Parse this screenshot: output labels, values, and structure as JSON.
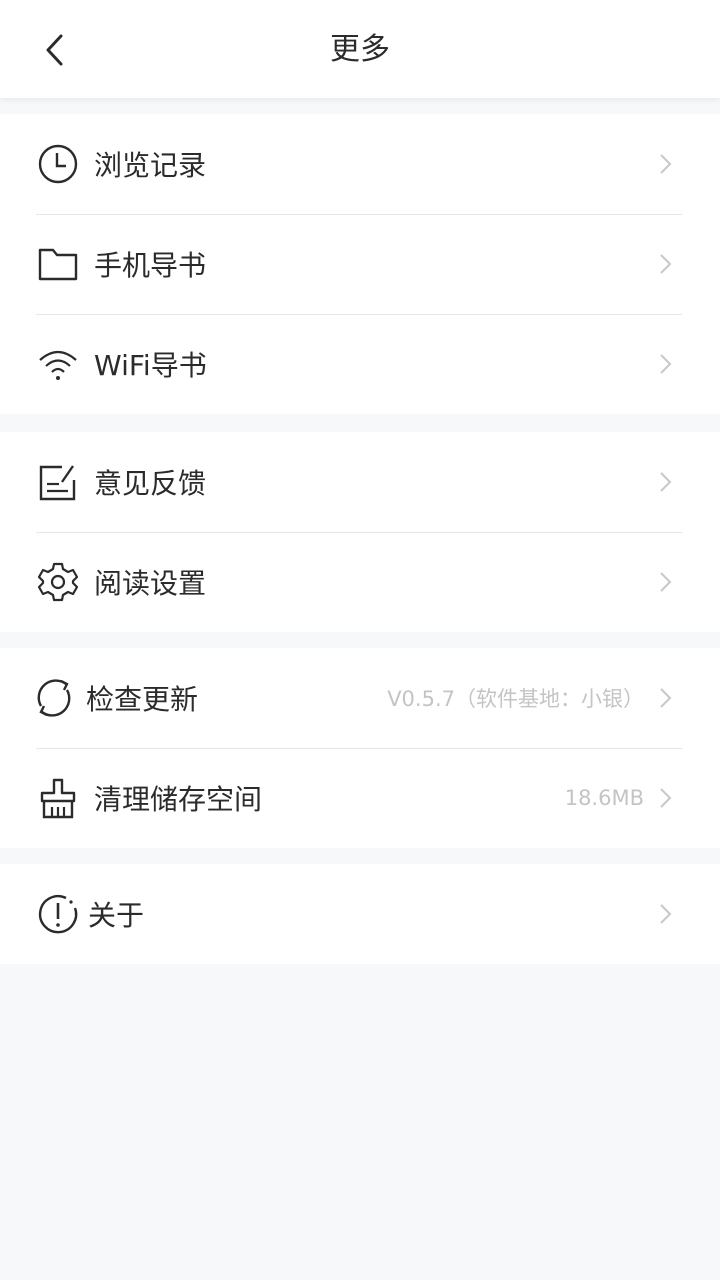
{
  "header": {
    "title": "更多",
    "back_icon": "chevron-left-icon"
  },
  "groups": [
    {
      "items": [
        {
          "icon": "clock-icon",
          "label": "浏览记录",
          "value": ""
        },
        {
          "icon": "folder-icon",
          "label": "手机导书",
          "value": ""
        },
        {
          "icon": "wifi-icon",
          "label": "WiFi导书",
          "value": ""
        }
      ]
    },
    {
      "items": [
        {
          "icon": "feedback-edit-icon",
          "label": "意见反馈",
          "value": ""
        },
        {
          "icon": "gear-icon",
          "label": "阅读设置",
          "value": ""
        }
      ]
    },
    {
      "items": [
        {
          "icon": "refresh-icon",
          "label": "检查更新",
          "value": "V0.5.7（软件基地：小银）"
        },
        {
          "icon": "broom-icon",
          "label": "清理储存空间",
          "value": "18.6MB"
        }
      ]
    },
    {
      "items": [
        {
          "icon": "info-icon",
          "label": "关于",
          "value": ""
        }
      ]
    }
  ],
  "colors": {
    "background": "#f7f8f9",
    "card": "#ffffff",
    "text": "#2b2b2b",
    "secondary": "#c4c4c4"
  }
}
